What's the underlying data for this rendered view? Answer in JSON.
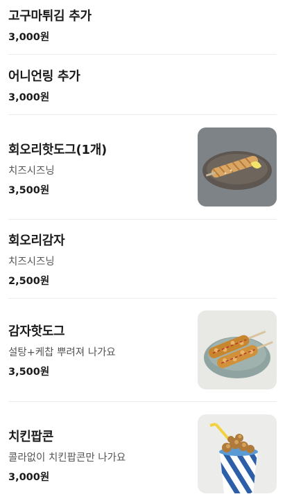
{
  "menu": {
    "items": [
      {
        "name": "고구마튀김 추가",
        "description": "",
        "price": "3,000원",
        "has_image": false,
        "image_icon": ""
      },
      {
        "name": "어니언링 추가",
        "description": "",
        "price": "3,000원",
        "has_image": false,
        "image_icon": ""
      },
      {
        "name": "회오리핫도그(1개)",
        "description": "치즈시즈닝",
        "price": "3,500원",
        "has_image": true,
        "image_icon": "tornado-hotdog-photo"
      },
      {
        "name": "회오리감자",
        "description": "치즈시즈닝",
        "price": "2,500원",
        "has_image": false,
        "image_icon": ""
      },
      {
        "name": "감자핫도그",
        "description": "설탕+케찹 뿌려져 나가요",
        "price": "3,500원",
        "has_image": true,
        "image_icon": "potato-hotdog-photo"
      },
      {
        "name": "치킨팝콘",
        "description": "콜라없이 치킨팝콘만 나가요",
        "price": "3,000원",
        "has_image": true,
        "image_icon": "chicken-popcorn-photo"
      }
    ]
  }
}
